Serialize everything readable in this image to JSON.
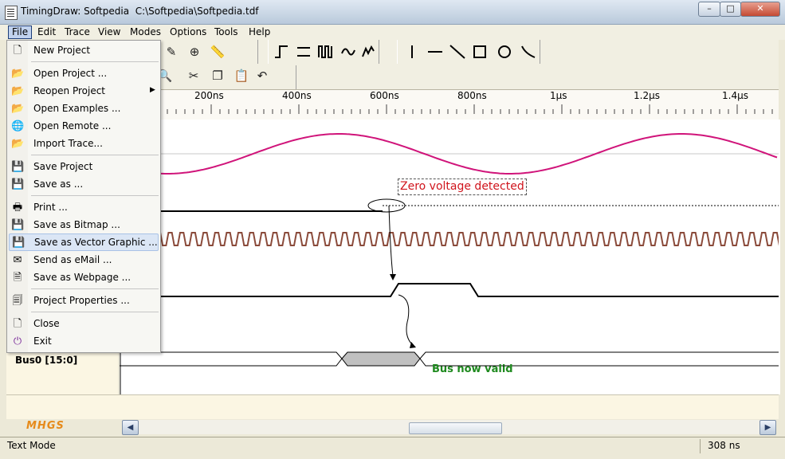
{
  "window": {
    "title": "TimingDraw: Softpedia  C:\\Softpedia\\Softpedia.tdf",
    "minimize": "–",
    "maximize": "□",
    "close": "✕"
  },
  "menubar": [
    "File",
    "Edit",
    "Trace",
    "View",
    "Modes",
    "Options",
    "Tools",
    "Help"
  ],
  "file_menu": [
    {
      "label": "New Project",
      "icon": "new-document-icon"
    },
    {
      "label": "Open Project ...",
      "icon": "open-folder-icon"
    },
    {
      "label": "Reopen Project",
      "icon": "open-folder-icon",
      "submenu": true
    },
    {
      "label": "Open Examples ...",
      "icon": "open-folder-icon"
    },
    {
      "label": "Open Remote ...",
      "icon": "globe-icon"
    },
    {
      "label": "Import Trace...",
      "icon": "open-folder-icon"
    },
    {
      "label": "Save Project",
      "icon": "floppy-icon"
    },
    {
      "label": "Save as ...",
      "icon": "floppy-icon"
    },
    {
      "label": "Print ...",
      "icon": "printer-icon"
    },
    {
      "label": "Save as Bitmap ...",
      "icon": "floppy-icon"
    },
    {
      "label": "Save as Vector Graphic ...",
      "icon": "floppy-icon",
      "highlighted": true
    },
    {
      "label": "Send as eMail ...",
      "icon": "envelope-icon"
    },
    {
      "label": "Save as Webpage ...",
      "icon": "webpage-icon"
    },
    {
      "label": "Project Properties ...",
      "icon": "properties-icon"
    },
    {
      "label": "Close",
      "icon": "close-document-icon"
    },
    {
      "label": "Exit",
      "icon": "exit-icon"
    }
  ],
  "ruler": {
    "ticks": [
      "200ns",
      "400ns",
      "600ns",
      "800ns",
      "1µs",
      "1.2µs",
      "1.4µs"
    ]
  },
  "signals": {
    "bus_name": "Bus0 [15:0]"
  },
  "annotations": {
    "zero_voltage": "Zero voltage detected",
    "bus_valid": "Bus now valid"
  },
  "logo": "MHGS",
  "statusbar": {
    "mode": "Text Mode",
    "time": "308 ns"
  },
  "colors": {
    "sine": "#d0147a",
    "clock": "#8a4a3a",
    "zero_text": "#d0141c",
    "bus_valid_text": "#1f8a1f",
    "bus_invalid_fill": "#c0c0c0"
  }
}
